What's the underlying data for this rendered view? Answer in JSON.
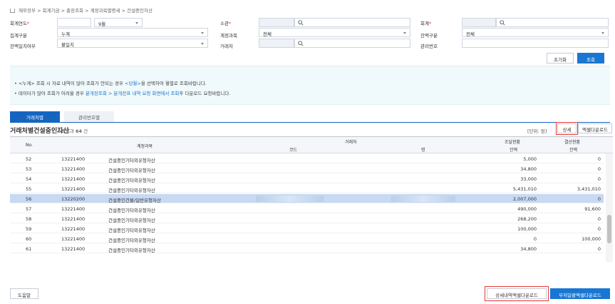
{
  "breadcrumb": [
    "재무장부",
    "회계기금",
    "총장조회",
    "계정과목별명세",
    "건설중인자산"
  ],
  "filters": {
    "fiscal_year_label": "회계연도",
    "fiscal_year_value": "",
    "month_value": "9월",
    "unit_label": "소관",
    "unit_value": "",
    "account_label": "회계",
    "account_value": "",
    "aggregation_label": "집계구분",
    "aggregation_value": "누계",
    "subject_label": "계정과목",
    "subject_value": "전체",
    "balance_type_label": "잔액구분",
    "balance_type_value": "전체",
    "balance_match_label": "잔액일치여부",
    "balance_match_value": "불일치",
    "vendor_label": "거래처",
    "vendor_value": "",
    "mgmt_no_label": "관리번호",
    "mgmt_no_value": ""
  },
  "buttons": {
    "reset": "초기화",
    "search": "조회",
    "detail": "상세",
    "excel_download": "엑셀다운로드",
    "help": "도움말",
    "detail_excel": "상세내역엑셀다운로드",
    "attached_excel": "부처일괄엑셀다운로드"
  },
  "notice": {
    "line1_a": "• <누계> 조회 시 자료 내역이 많아 조회가 안되는 경우 ",
    "line1_b": "<당월>",
    "line1_c": "을 선택하여 월별로 조회바랍니다.",
    "line2_a": "• 데이터가 많아 조회가 어려울 경우 ",
    "line2_b": "분개장조회 > 분개전표 내역 요청 화면에서 조회",
    "line2_c": "후 다운로드 요청바랍니다."
  },
  "tabs": [
    "거래처별",
    "관리번호별"
  ],
  "grid": {
    "title": "거래처별건설중인자산",
    "count_prefix": "조회결과",
    "count_value": "64",
    "count_suffix": "건",
    "unit_note": "[단위: 원]",
    "headers": {
      "no": "No.",
      "subject": "계정과목",
      "vendor": "거래처",
      "code": "코드",
      "name": "명",
      "procurement": "조달현황",
      "settlement": "결산현황",
      "balance1": "잔액",
      "balance2": "잔액"
    },
    "rows": [
      {
        "no": "52",
        "code": "13221400",
        "subject": "건설중인기타외유형자산",
        "proc": "5,000",
        "settle": "0",
        "selected": false
      },
      {
        "no": "53",
        "code": "13221400",
        "subject": "건설중인기타외유형자산",
        "proc": "34,800",
        "settle": "0",
        "selected": false
      },
      {
        "no": "54",
        "code": "13221400",
        "subject": "건설중인기타외유형자산",
        "proc": "33,000",
        "settle": "0",
        "selected": false
      },
      {
        "no": "55",
        "code": "13221400",
        "subject": "건설중인기타외유형자산",
        "proc": "5,431,010",
        "settle": "3,431,010",
        "selected": false
      },
      {
        "no": "56",
        "code": "13220200",
        "subject": "건설중인건물/일반유형자산",
        "proc": "2,007,000",
        "settle": "0",
        "selected": true
      },
      {
        "no": "57",
        "code": "13221400",
        "subject": "건설중인기타외유형자산",
        "proc": "490,000",
        "settle": "91,600",
        "selected": false
      },
      {
        "no": "58",
        "code": "13221400",
        "subject": "건설중인기타외유형자산",
        "proc": "268,200",
        "settle": "0",
        "selected": false
      },
      {
        "no": "59",
        "code": "13221400",
        "subject": "건설중인기타외유형자산",
        "proc": "100,000",
        "settle": "0",
        "selected": false
      },
      {
        "no": "60",
        "code": "13221400",
        "subject": "건설중인기타외유형자산",
        "proc": "0",
        "settle": "100,000",
        "selected": false
      },
      {
        "no": "61",
        "code": "13221400",
        "subject": "건설중인기타외유형자산",
        "proc": "34,800",
        "settle": "0",
        "selected": false
      }
    ]
  },
  "colors": {
    "primary": "#1976d2",
    "highlight": "#e53935",
    "selected_row": "#c7d9f3"
  }
}
